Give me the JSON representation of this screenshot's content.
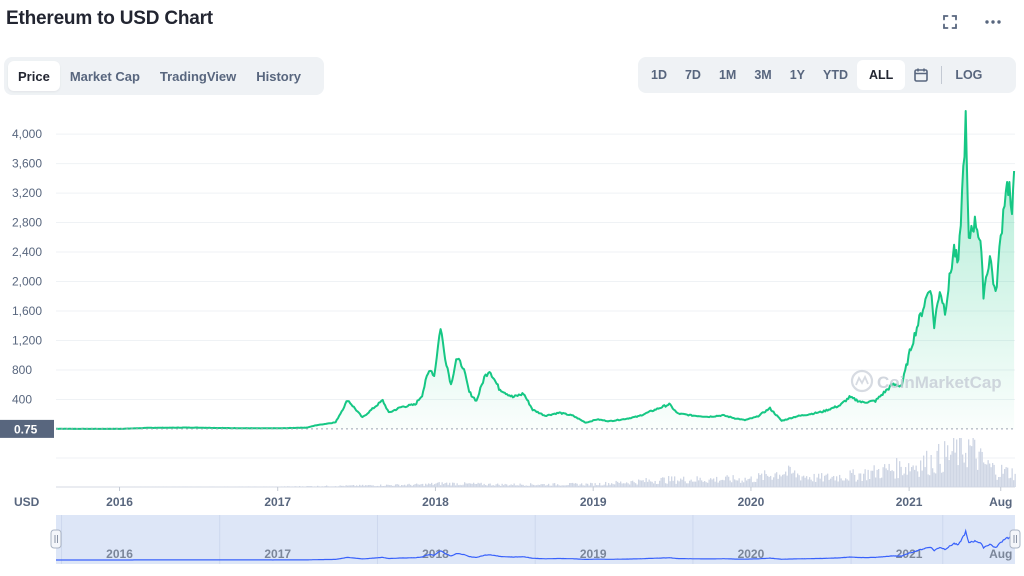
{
  "header": {
    "title": "Ethereum to USD Chart",
    "icons": [
      "fullscreen-icon",
      "more-icon"
    ]
  },
  "tabs": [
    {
      "label": "Price",
      "active": true
    },
    {
      "label": "Market Cap",
      "active": false
    },
    {
      "label": "TradingView",
      "active": false
    },
    {
      "label": "History",
      "active": false
    }
  ],
  "ranges": {
    "items": [
      "1D",
      "7D",
      "1M",
      "3M",
      "1Y",
      "YTD",
      "ALL"
    ],
    "active": "ALL",
    "calendar_icon": "calendar-icon",
    "log_label": "LOG"
  },
  "colors": {
    "line": "#16c784",
    "fill_top": "#16c784",
    "volume": "#cfd6e4",
    "navigator_fill": "#dde6f7",
    "navigator_line": "#3861fb",
    "grid": "#eff2f5",
    "label": "#58667e"
  },
  "chart_data": {
    "type": "line",
    "currency_label": "USD",
    "watermark": "CoinMarketCap",
    "y_ticks": [
      400,
      800,
      1200,
      1600,
      2000,
      2400,
      2800,
      3200,
      3600,
      4000
    ],
    "y_tick_labels": [
      "400",
      "800",
      "1,200",
      "1,600",
      "2,000",
      "2,400",
      "2,800",
      "3,200",
      "3,600",
      "4,000"
    ],
    "ylim": [
      -0.75,
      4300
    ],
    "current_label": "0.75",
    "current_value": 0.75,
    "x_ticks": [
      {
        "label": "2016",
        "date": "2016-01-01"
      },
      {
        "label": "2017",
        "date": "2017-01-01"
      },
      {
        "label": "2018",
        "date": "2018-01-01"
      },
      {
        "label": "2019",
        "date": "2019-01-01"
      },
      {
        "label": "2020",
        "date": "2020-01-01"
      },
      {
        "label": "2021",
        "date": "2021-01-01"
      },
      {
        "label": "Aug",
        "date": "2021-08-01"
      }
    ],
    "xlim": [
      "2015-08-07",
      "2021-09-03"
    ],
    "series": [
      {
        "points": [
          [
            "2015-08-07",
            2.8
          ],
          [
            "2015-10-01",
            0.7
          ],
          [
            "2016-01-01",
            0.95
          ],
          [
            "2016-03-13",
            15
          ],
          [
            "2016-06-15",
            19
          ],
          [
            "2016-09-01",
            12
          ],
          [
            "2016-12-01",
            8
          ],
          [
            "2017-01-15",
            10
          ],
          [
            "2017-03-10",
            19
          ],
          [
            "2017-03-31",
            50
          ],
          [
            "2017-05-15",
            90
          ],
          [
            "2017-06-12",
            395
          ],
          [
            "2017-07-16",
            155
          ],
          [
            "2017-08-14",
            300
          ],
          [
            "2017-09-01",
            387
          ],
          [
            "2017-09-15",
            220
          ],
          [
            "2017-10-15",
            300
          ],
          [
            "2017-11-15",
            330
          ],
          [
            "2017-12-01",
            460
          ],
          [
            "2017-12-12",
            700
          ],
          [
            "2017-12-20",
            820
          ],
          [
            "2017-12-29",
            720
          ],
          [
            "2018-01-13",
            1390
          ],
          [
            "2018-01-21",
            1050
          ],
          [
            "2018-02-06",
            600
          ],
          [
            "2018-02-18",
            950
          ],
          [
            "2018-03-05",
            860
          ],
          [
            "2018-03-20",
            500
          ],
          [
            "2018-04-06",
            380
          ],
          [
            "2018-04-24",
            700
          ],
          [
            "2018-05-06",
            800
          ],
          [
            "2018-05-28",
            550
          ],
          [
            "2018-06-29",
            430
          ],
          [
            "2018-07-24",
            480
          ],
          [
            "2018-08-14",
            260
          ],
          [
            "2018-09-12",
            180
          ],
          [
            "2018-10-15",
            220
          ],
          [
            "2018-11-15",
            180
          ],
          [
            "2018-12-15",
            85
          ],
          [
            "2019-01-10",
            130
          ],
          [
            "2019-02-07",
            105
          ],
          [
            "2019-03-15",
            135
          ],
          [
            "2019-04-15",
            170
          ],
          [
            "2019-05-15",
            240
          ],
          [
            "2019-06-26",
            335
          ],
          [
            "2019-07-15",
            210
          ],
          [
            "2019-08-15",
            185
          ],
          [
            "2019-09-24",
            165
          ],
          [
            "2019-10-28",
            185
          ],
          [
            "2019-11-25",
            145
          ],
          [
            "2019-12-18",
            120
          ],
          [
            "2020-01-15",
            165
          ],
          [
            "2020-02-14",
            280
          ],
          [
            "2020-03-12",
            110
          ],
          [
            "2020-04-15",
            170
          ],
          [
            "2020-05-15",
            200
          ],
          [
            "2020-06-15",
            235
          ],
          [
            "2020-07-25",
            320
          ],
          [
            "2020-08-16",
            430
          ],
          [
            "2020-09-15",
            360
          ],
          [
            "2020-10-15",
            380
          ],
          [
            "2020-11-23",
            600
          ],
          [
            "2020-12-15",
            590
          ],
          [
            "2021-01-05",
            1100
          ],
          [
            "2021-01-19",
            1380
          ],
          [
            "2021-02-19",
            1950
          ],
          [
            "2021-02-28",
            1400
          ],
          [
            "2021-03-13",
            1900
          ],
          [
            "2021-03-25",
            1600
          ],
          [
            "2021-04-15",
            2450
          ],
          [
            "2021-04-25",
            2200
          ],
          [
            "2021-05-12",
            4170
          ],
          [
            "2021-05-19",
            2500
          ],
          [
            "2021-05-25",
            2750
          ],
          [
            "2021-06-05",
            2800
          ],
          [
            "2021-06-15",
            2550
          ],
          [
            "2021-06-22",
            1850
          ],
          [
            "2021-07-07",
            2350
          ],
          [
            "2021-07-20",
            1800
          ],
          [
            "2021-08-01",
            2600
          ],
          [
            "2021-08-13",
            3300
          ],
          [
            "2021-08-21",
            3280
          ],
          [
            "2021-08-27",
            2800
          ],
          [
            "2021-09-01",
            3500
          ]
        ]
      }
    ],
    "volume_scale_max": 100,
    "volume": [
      [
        "2015-08-07",
        0.3
      ],
      [
        "2017-01-01",
        1
      ],
      [
        "2017-06-01",
        3
      ],
      [
        "2017-12-01",
        6
      ],
      [
        "2018-01-15",
        9
      ],
      [
        "2018-06-01",
        6
      ],
      [
        "2019-01-01",
        7
      ],
      [
        "2019-06-15",
        18
      ],
      [
        "2020-01-01",
        20
      ],
      [
        "2020-03-12",
        38
      ],
      [
        "2020-06-01",
        22
      ],
      [
        "2020-09-01",
        30
      ],
      [
        "2021-01-10",
        55
      ],
      [
        "2021-02-20",
        65
      ],
      [
        "2021-05-19",
        100
      ],
      [
        "2021-06-20",
        60
      ],
      [
        "2021-07-20",
        42
      ],
      [
        "2021-09-01",
        35
      ]
    ]
  }
}
